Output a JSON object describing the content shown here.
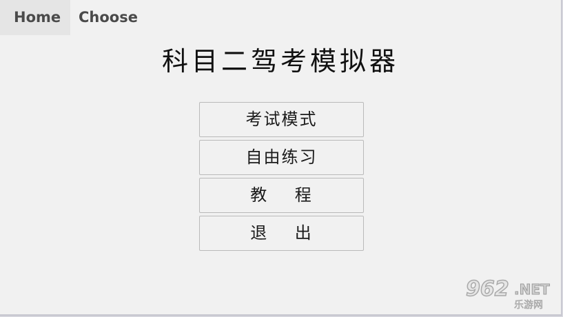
{
  "tabs": [
    {
      "label": "Home",
      "active": true
    },
    {
      "label": "Choose",
      "active": false
    }
  ],
  "title": "科目二驾考模拟器",
  "menu": {
    "exam_mode": "考试模式",
    "free_practice": "自由练习",
    "tutorial": "教    程",
    "exit": "退    出"
  },
  "watermark": {
    "digits": "962",
    "net": ".NET",
    "sub": "乐游网"
  },
  "colors": {
    "background": "#f1f1f1",
    "active_tab": "#e5e5e5",
    "button_border": "#b9b9b9",
    "text": "#1a1a1a"
  }
}
